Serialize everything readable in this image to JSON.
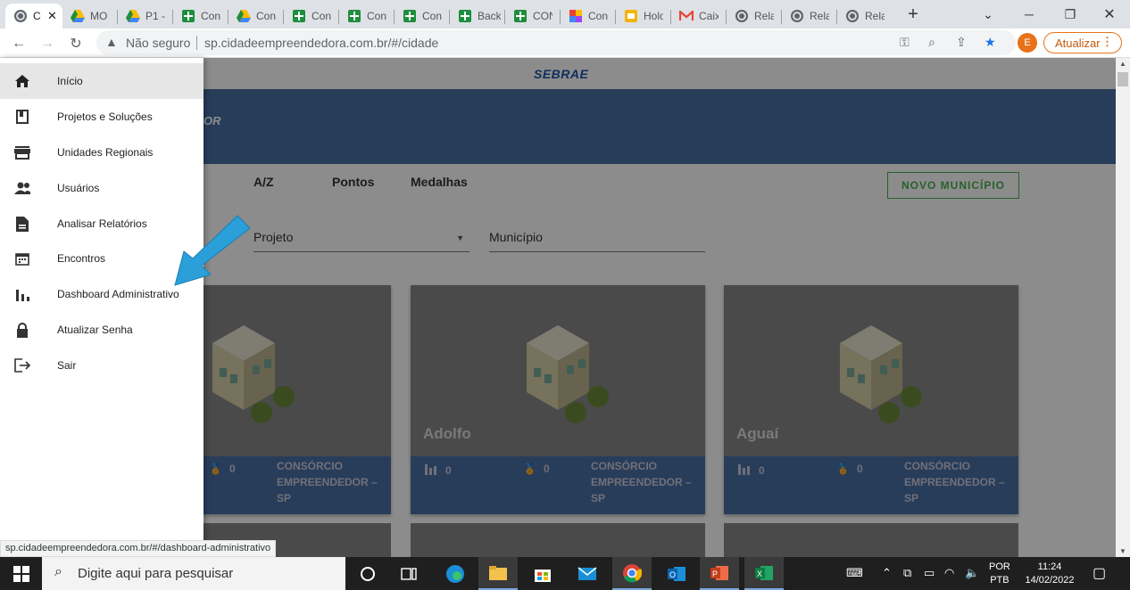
{
  "browser": {
    "tabs": [
      {
        "label": "C",
        "icon": "globe-icon",
        "active": true
      },
      {
        "label": "MO",
        "icon": "drive-icon"
      },
      {
        "label": "P1 -",
        "icon": "drive-icon"
      },
      {
        "label": "Con",
        "icon": "sheets-icon"
      },
      {
        "label": "Con",
        "icon": "drive-icon"
      },
      {
        "label": "Con",
        "icon": "sheets-icon"
      },
      {
        "label": "Con",
        "icon": "sheets-icon"
      },
      {
        "label": "Con",
        "icon": "sheets-icon"
      },
      {
        "label": "Back",
        "icon": "sheets-icon"
      },
      {
        "label": "CON",
        "icon": "sheets-icon"
      },
      {
        "label": "Con",
        "icon": "color-grid-icon"
      },
      {
        "label": "Holo",
        "icon": "slides-icon"
      },
      {
        "label": "Caix",
        "icon": "gmail-icon"
      },
      {
        "label": "Rela",
        "icon": "globe-icon"
      },
      {
        "label": "Rela",
        "icon": "globe-icon"
      },
      {
        "label": "Rela",
        "icon": "globe-icon"
      }
    ],
    "new_tab_label": "+",
    "security_label": "Não seguro",
    "url": "sp.cidadeempreendedora.com.br/#/cidade",
    "profile_initial": "E",
    "update_label": "Atualizar",
    "status_url": "sp.cidadeempreendedora.com.br/#/dashboard-administrativo"
  },
  "page": {
    "logo": "SEBRAE",
    "banner_text": "OR",
    "tabs": [
      "A/Z",
      "Pontos",
      "Medalhas"
    ],
    "new_button": "NOVO MUNICÍPIO",
    "filters": {
      "project": "Projeto",
      "municipality": "Município"
    },
    "cards": [
      {
        "name": "",
        "points": "",
        "medals": "0",
        "consortium": "CONSÓRCIO EMPREENDEDOR – SP"
      },
      {
        "name": "Adolfo",
        "points": "0",
        "medals": "0",
        "consortium": "CONSÓRCIO EMPREENDEDOR – SP"
      },
      {
        "name": "Aguaí",
        "points": "0",
        "medals": "0",
        "consortium": "CONSÓRCIO EMPREENDEDOR – SP"
      }
    ]
  },
  "drawer": {
    "items": [
      {
        "label": "Início",
        "icon": "home-icon",
        "active": true
      },
      {
        "label": "Projetos e Soluções",
        "icon": "bookmark-icon"
      },
      {
        "label": "Unidades Regionais",
        "icon": "store-icon"
      },
      {
        "label": "Usuários",
        "icon": "people-icon"
      },
      {
        "label": "Analisar Relatórios",
        "icon": "report-icon"
      },
      {
        "label": "Encontros",
        "icon": "calendar-icon"
      },
      {
        "label": "Dashboard Administrativo",
        "icon": "bar-chart-icon"
      },
      {
        "label": "Atualizar Senha",
        "icon": "lock-icon"
      },
      {
        "label": "Sair",
        "icon": "exit-icon"
      }
    ]
  },
  "taskbar": {
    "search_placeholder": "Digite aqui para pesquisar",
    "lang_1": "POR",
    "lang_2": "PTB",
    "time": "11:24",
    "date": "14/02/2022"
  }
}
